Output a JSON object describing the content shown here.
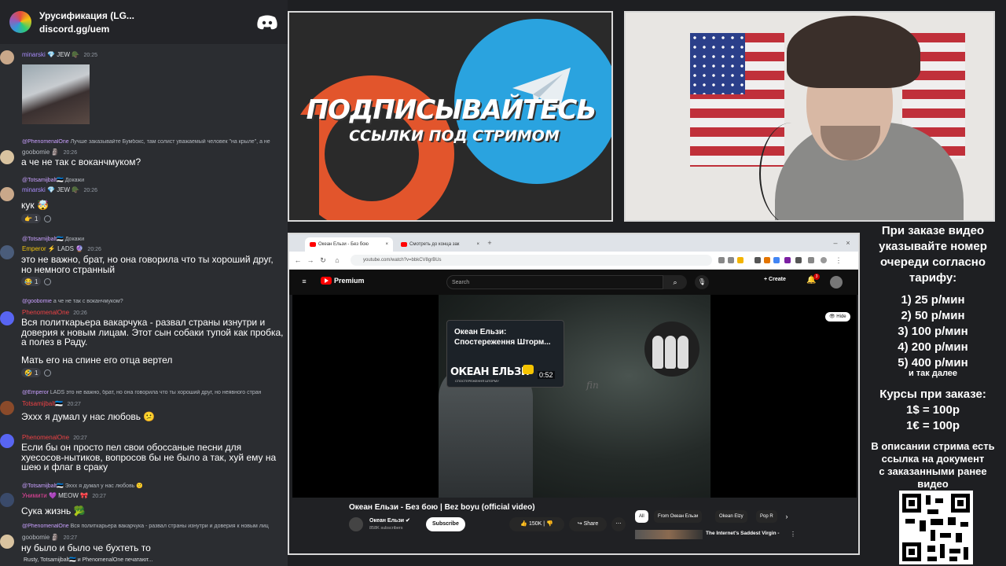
{
  "discord": {
    "server_name": "Урусификация (LG...",
    "server_link": "discord.gg/uem",
    "typing_indicator": "Rusty, Totsamijbalt🇪🇪 и PhenomenalOne печатают...",
    "messages": [
      {
        "user": "minarski",
        "badges": "💎 JEW 🪖",
        "time": "20:25",
        "text": "",
        "user_color": "#a78bfa",
        "has_image": true
      },
      {
        "reply_to": "@PhenomenalOne",
        "reply_text": "Лучше заказывайте Бумбокс, там солист уважаемый человек \"на крыле\", а не",
        "user": "goobomie",
        "badges": "🗿",
        "time": "20:26",
        "text": "а че не так с воканчмуком?",
        "user_color": "#b5bac1"
      },
      {
        "reply_to": "@Totsamijbalt🇪🇪",
        "reply_text": "Докажи",
        "user": "minarski",
        "badges": "💎 JEW 🪖",
        "time": "20:26",
        "text": "кук 🤯",
        "user_color": "#a78bfa",
        "reaction": "1"
      },
      {
        "reply_to": "@Totsamijbalt🇪🇪",
        "reply_text": "Докажи",
        "user": "Emperor",
        "badges": "⚡ LADS 🔮",
        "time": "20:26",
        "text": "это не важно, брат, но она говорила что ты хороший друг, но немного странный",
        "user_color": "#f1c40f",
        "reaction": "1"
      },
      {
        "reply_to": "@goobomie",
        "reply_text": "а че не так с воканчмуком?",
        "user": "PhenomenalOne",
        "badges": "",
        "time": "20:26",
        "text": "Вся политкарьера вакарчука - развал страны изнутри и доверия к новым лицам. Этот сын собаки тупой как пробка, а полез в Раду.",
        "user_color": "#ed4245"
      },
      {
        "text": "Мать его на спине его отца вертел",
        "reaction": "1"
      },
      {
        "reply_to": "@Emperor",
        "reply_text": "LADS это не важно, брат, но она говорила что ты хороший друг, но неявного стран",
        "user": "Totsamijbalt🇪🇪",
        "badges": "",
        "time": "20:27",
        "text": "Эххх я думал у нас любовь 😕",
        "user_color": "#ed4245"
      },
      {
        "reply_to": "",
        "reply_text": "",
        "user": "PhenomenalOne",
        "badges": "",
        "time": "20:27",
        "text": "Если бы он просто пел свои обоссаные песни для хуесосов-нытиков, вопросов бы не было а так, хуй ему на шею и флаг в сраку",
        "user_color": "#ed4245"
      },
      {
        "reply_to": "@Totsamijbalt🇪🇪",
        "reply_text": "Эххх я думал у нас любовь 🙁",
        "user": "Унимити",
        "badges": "💜 MEOW 🎀",
        "time": "20:27",
        "text": "Сука жизнь 🥦",
        "user_color": "#eb459e"
      },
      {
        "reply_to": "@PhenomenalOne",
        "reply_text": "Вся политкарьера вакарчука - развал страны изнутри и доверия к новым лиц",
        "user": "goobomie",
        "badges": "🗿",
        "time": "20:27",
        "text": "ну было и было че бухтеть то",
        "user_color": "#b5bac1"
      }
    ]
  },
  "promo": {
    "title": "ПОДПИСЫВАЙТЕСЬ",
    "subtitle": "ССЫЛКИ ПОД СТРИМОМ"
  },
  "browser": {
    "tabs": [
      "Океан Ельзи - Без бою",
      "Смотреть до конца зак"
    ],
    "url": "youtube.com/watch?v=bbkCV8grBUs",
    "youtube": {
      "logo": "Premium",
      "search_placeholder": "Search",
      "create": "Create",
      "notif_count": "3",
      "hide": "Hide",
      "card_title": "Океан Ельзи: Спостереження Шторм...",
      "card_brand": "ОКЕАН ЕЛЬЗИ",
      "card_sub": "СПОСТЕРЕЖЕННЯ ШТОРМУ",
      "card_duration": "0:52",
      "video_watermark": "fin",
      "video_title": "Океан Ельзи - Без бою | Bez boyu (official video)",
      "channel_name": "Океан Ельзи ✔",
      "subscribers": "858K subscribers",
      "subscribe": "Subscribe",
      "likes": "150K",
      "share": "Share",
      "chips": [
        "All",
        "From Океан Ельзи",
        "Okean Elzy",
        "Pop R"
      ],
      "rec_title": "The Internet's Saddest Virgin -"
    }
  },
  "info": {
    "intro": [
      "При заказе видео",
      "указывайте номер",
      "очереди согласно",
      "тарифу:"
    ],
    "tariffs": [
      "1) 25 р/мин",
      "2) 50 р/мин",
      "3) 100 р/мин",
      "4) 200 р/мин",
      "5) 400 р/мин"
    ],
    "etc": "и так далее",
    "rates_title": "Курсы при заказе:",
    "rates": [
      "1$ = 100р",
      "1€ = 100р"
    ],
    "doc_note": [
      "В описании стрима есть",
      "ссылка на документ",
      "с заказанными ранее",
      "видео"
    ]
  }
}
